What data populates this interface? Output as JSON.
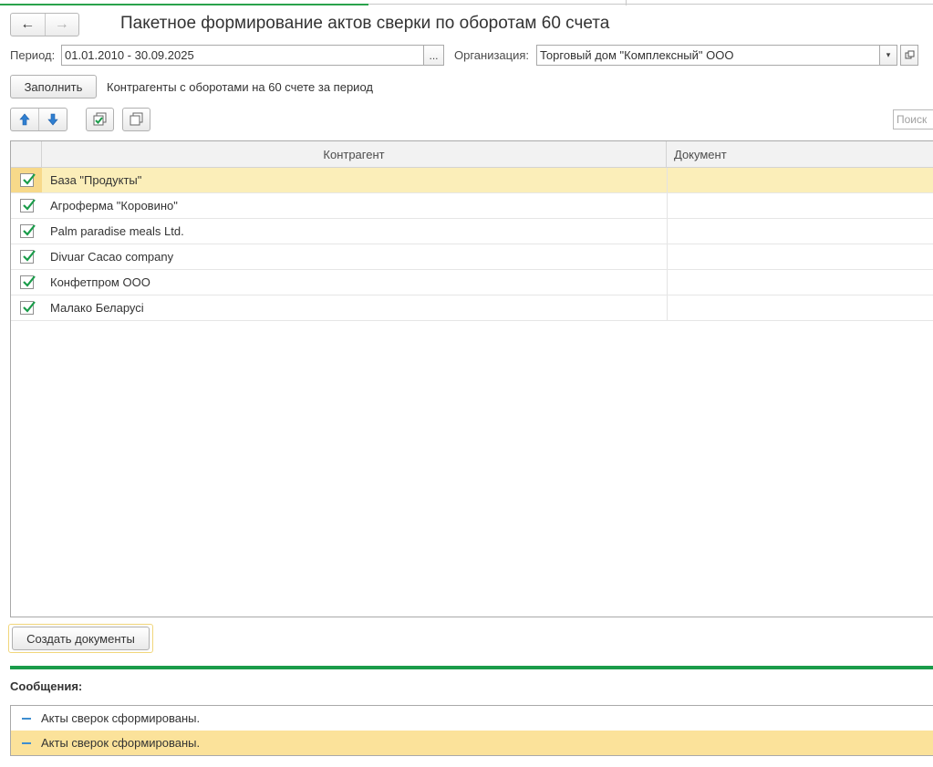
{
  "header": {
    "title": "Пакетное формирование актов сверки по оборотам 60 счета",
    "back_icon": "←",
    "forward_icon": "→"
  },
  "filters": {
    "period_label": "Период:",
    "period_value": "01.01.2010 - 30.09.2025",
    "period_button": "...",
    "org_label": "Организация:",
    "org_value": "Торговый дом \"Комплексный\" ООО",
    "org_dropdown_icon": "▾",
    "org_open_icon": "open-icon"
  },
  "fill": {
    "button_label": "Заполнить",
    "description": "Контрагенты с оборотами на 60 счете за период"
  },
  "toolbar": {
    "move_up_icon": "arrow-up-icon",
    "move_down_icon": "arrow-down-icon",
    "check_all_icon": "check-all-icon",
    "uncheck_all_icon": "uncheck-all-icon",
    "search_placeholder": "Поиск"
  },
  "table": {
    "columns": [
      "",
      "Контрагент",
      "Документ"
    ],
    "rows": [
      {
        "checked": true,
        "name": "База \"Продукты\"",
        "document": ""
      },
      {
        "checked": true,
        "name": "Агроферма \"Коровино\"",
        "document": ""
      },
      {
        "checked": true,
        "name": "Palm paradise meals Ltd.",
        "document": ""
      },
      {
        "checked": true,
        "name": "Divuar Cacao company",
        "document": ""
      },
      {
        "checked": true,
        "name": "Конфетпром ООО",
        "document": ""
      },
      {
        "checked": true,
        "name": "Малако Беларусi",
        "document": ""
      }
    ]
  },
  "actions": {
    "create_label": "Создать документы"
  },
  "messages": {
    "title": "Сообщения:",
    "items": [
      "Акты сверок сформированы.",
      "Акты сверок сформированы."
    ]
  },
  "colors": {
    "accent_green": "#1a9c4a",
    "selection": "#fbeeb9",
    "check": "#1a9c4a",
    "arrow_blue": "#2f7fd1"
  }
}
